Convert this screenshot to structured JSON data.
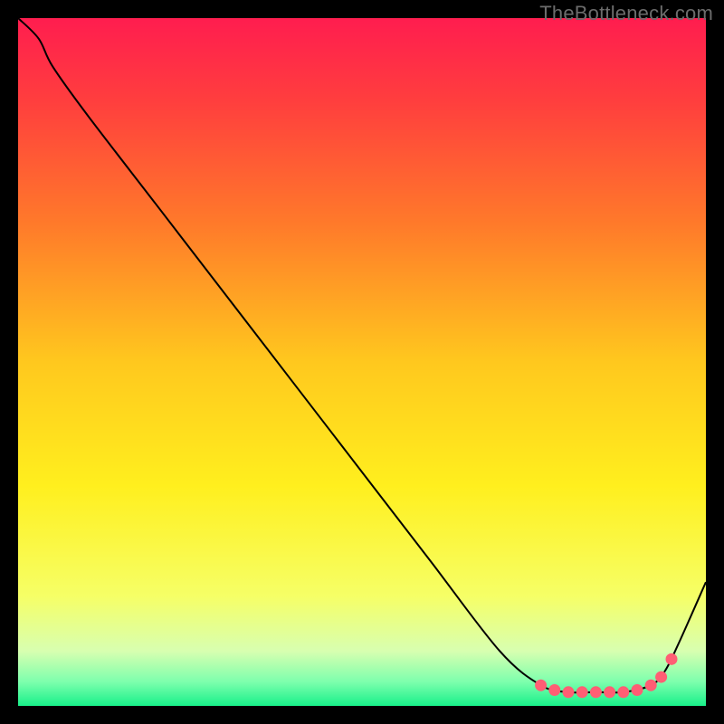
{
  "watermark": "TheBottleneck.com",
  "chart_data": {
    "type": "line",
    "title": "",
    "xlabel": "",
    "ylabel": "",
    "xlim": [
      0,
      100
    ],
    "ylim": [
      0,
      100
    ],
    "series": [
      {
        "name": "curve",
        "x": [
          0,
          3,
          5,
          10,
          20,
          30,
          40,
          50,
          60,
          70,
          76,
          80,
          84,
          88,
          92,
          94,
          96,
          100
        ],
        "y": [
          100,
          97,
          93,
          86,
          73,
          60,
          47,
          34,
          21,
          8,
          3,
          2,
          2,
          2,
          3,
          5,
          9,
          18
        ]
      }
    ],
    "markers": {
      "name": "valley-points",
      "x": [
        76,
        78,
        80,
        82,
        84,
        86,
        88,
        90,
        92,
        93.5,
        95
      ],
      "y": [
        3.0,
        2.3,
        2.0,
        2.0,
        2.0,
        2.0,
        2.0,
        2.3,
        3.0,
        4.2,
        6.8
      ]
    },
    "gradient_stops": [
      {
        "offset": 0.0,
        "color": "#ff1d4f"
      },
      {
        "offset": 0.12,
        "color": "#ff3e3e"
      },
      {
        "offset": 0.3,
        "color": "#ff7a2a"
      },
      {
        "offset": 0.5,
        "color": "#ffc81e"
      },
      {
        "offset": 0.68,
        "color": "#ffef1e"
      },
      {
        "offset": 0.84,
        "color": "#f6ff66"
      },
      {
        "offset": 0.92,
        "color": "#d8ffb0"
      },
      {
        "offset": 0.965,
        "color": "#7dffad"
      },
      {
        "offset": 1.0,
        "color": "#18f08a"
      }
    ],
    "marker_color": "#ff5e74",
    "line_color": "#000000"
  }
}
